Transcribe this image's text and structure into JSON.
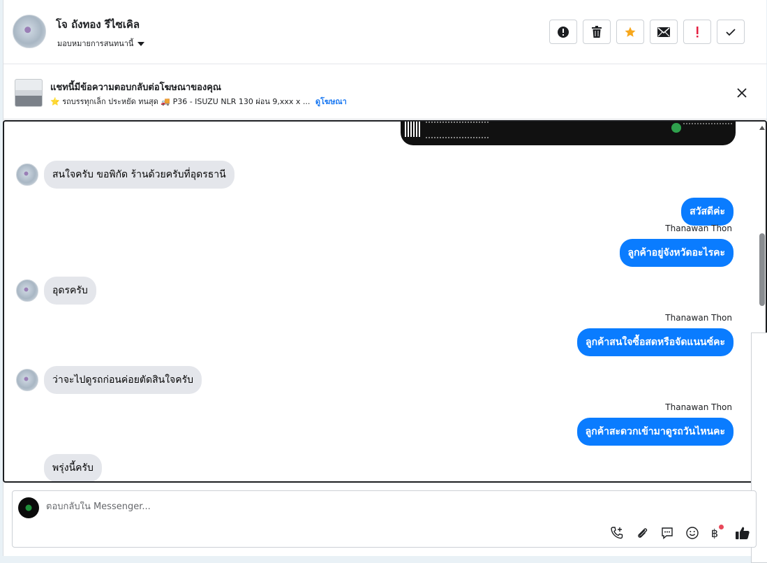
{
  "header": {
    "contact_name": "โจ ถังทอง รีไซเคิล",
    "assign_label": "มอบหมายการสนทนานี้",
    "actions": [
      {
        "icon": "alert-circle-icon",
        "label": "report"
      },
      {
        "icon": "trash-icon",
        "label": "delete"
      },
      {
        "icon": "star-icon",
        "label": "star"
      },
      {
        "icon": "envelope-icon",
        "label": "mark-unread"
      },
      {
        "icon": "exclamation-icon",
        "label": "spam"
      },
      {
        "icon": "check-icon",
        "label": "done"
      }
    ]
  },
  "ad_notice": {
    "title": "แชทนี้มีข้อความตอบกลับต่อโฆษณาของคุณ",
    "subtitle": "⭐ รถบรรทุกเล็ก ประหยัด ทนสุด 🚚 P36 - ISUZU NLR 130 ผ่อน 9,xxx x ...",
    "link": "ดูโฆษณา"
  },
  "messages": [
    {
      "side": "in",
      "text": "สนใจครับ ขอพิกัด ร้านด้วยครับที่อุดรธานี"
    },
    {
      "side": "out",
      "text": "สวัสดีค่ะ"
    },
    {
      "side": "out",
      "sender": "Thanawan Thon",
      "text": "ลูกค้าอยู่จังหวัดอะไรคะ"
    },
    {
      "side": "in",
      "text": "อุดรครับ"
    },
    {
      "side": "out",
      "sender": "Thanawan Thon",
      "text": "ลูกค้าสนใจซื้อสดหรือจัดแนนซ์คะ"
    },
    {
      "side": "in",
      "text": "ว่าจะไปดูรถก่อนค่อยตัดสินใจครับ"
    },
    {
      "side": "out",
      "sender": "Thanawan Thon",
      "text": "ลูกค้าสะดวกเข้ามาดูรถวันไหนคะ"
    },
    {
      "side": "in",
      "text": "พรุ่งนี้ครับ"
    }
  ],
  "composer": {
    "placeholder": "ตอบกลับใน Messenger...",
    "baht_symbol": "฿"
  }
}
